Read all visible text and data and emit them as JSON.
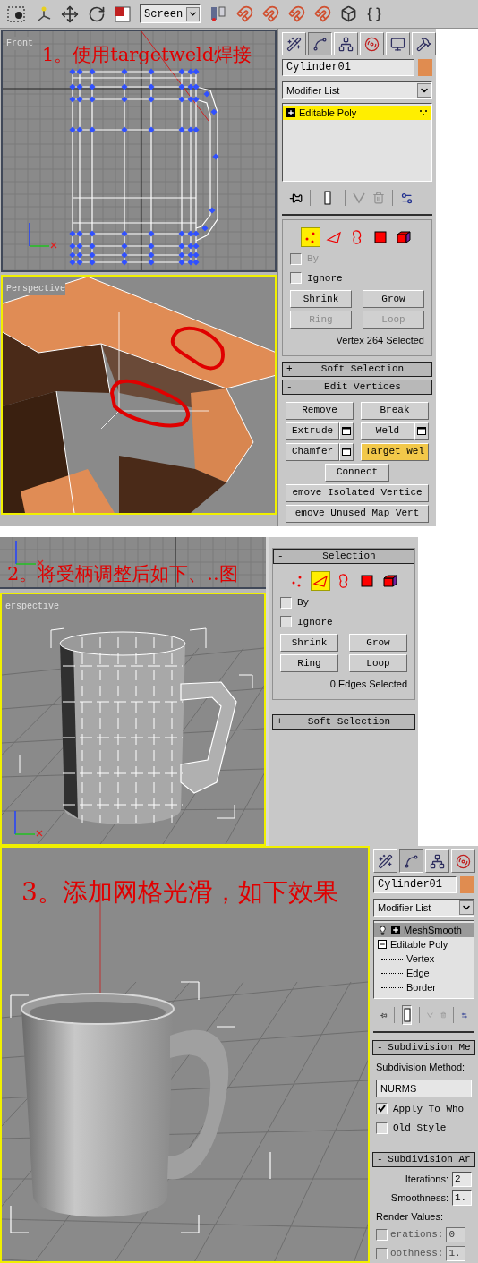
{
  "step1": {
    "caption": "1。使用targetweld焊接",
    "ref_coord": "Screen",
    "viewports": [
      {
        "label": "Front",
        "active": false
      },
      {
        "label": "Perspective",
        "active": true
      }
    ],
    "panel": {
      "tabs": [
        {
          "kind": "create",
          "selected": false
        },
        {
          "kind": "modify",
          "selected": true
        },
        {
          "kind": "hierarchy",
          "selected": false
        },
        {
          "kind": "motion",
          "selected": false
        },
        {
          "kind": "display",
          "selected": false
        },
        {
          "kind": "utilities",
          "selected": false
        }
      ],
      "object_name": "Cylinder01",
      "modifier_list": "Modifier List",
      "show_end_result": false,
      "stack": [
        {
          "label": "Editable Poly",
          "kind": "base",
          "selected": true,
          "expanded": false
        }
      ],
      "levels": [
        {
          "kind": "vertex",
          "selected": true
        },
        {
          "kind": "edge",
          "selected": false
        },
        {
          "kind": "border",
          "selected": false
        },
        {
          "kind": "polygon",
          "selected": false
        },
        {
          "kind": "element",
          "selected": false
        }
      ],
      "checkboxes": [
        {
          "label": "By",
          "checked": false,
          "disabled": true
        },
        {
          "label": "Ignore",
          "checked": false,
          "disabled": false
        }
      ],
      "buttons": [
        {
          "label": "Shrink",
          "disabled": false
        },
        {
          "label": "Grow",
          "disabled": false
        },
        {
          "label": "Ring",
          "disabled": true
        },
        {
          "label": "Loop",
          "disabled": true
        }
      ],
      "status": "Vertex 264 Selected",
      "soft_selection": {
        "sign": "+",
        "title": "Soft Selection"
      },
      "edit_vertices": {
        "sign": "-",
        "title": "Edit Vertices",
        "rows": [
          [
            {
              "label": "Remove",
              "settings": false,
              "active": false
            },
            {
              "label": "Break",
              "settings": false,
              "active": false
            }
          ],
          [
            {
              "label": "Extrude",
              "settings": true,
              "active": false
            },
            {
              "label": "Weld",
              "settings": true,
              "active": false
            }
          ],
          [
            {
              "label": "Chamfer",
              "settings": true,
              "active": false
            },
            {
              "label": "Target Wel",
              "settings": false,
              "active": true
            }
          ],
          [
            {
              "label": "Connect",
              "settings": false,
              "active": false
            }
          ],
          [
            {
              "label": "emove Isolated Vertice",
              "settings": false,
              "active": false
            }
          ],
          [
            {
              "label": "emove Unused Map Vert",
              "settings": false,
              "active": false
            }
          ]
        ]
      }
    }
  },
  "step2": {
    "caption": "2。将受柄调整后如下、..图",
    "viewport": {
      "label": "erspective",
      "active": true
    },
    "panel": {
      "selection": {
        "sign": "-",
        "title": "Selection"
      },
      "levels": [
        {
          "kind": "vertex",
          "selected": false
        },
        {
          "kind": "edge",
          "selected": true
        },
        {
          "kind": "border",
          "selected": false
        },
        {
          "kind": "polygon",
          "selected": false
        },
        {
          "kind": "element",
          "selected": false
        }
      ],
      "checkboxes": [
        {
          "label": "By",
          "checked": false,
          "disabled": false
        },
        {
          "label": "Ignore",
          "checked": false,
          "disabled": false
        }
      ],
      "buttons": [
        {
          "label": "Shrink",
          "disabled": false
        },
        {
          "label": "Grow",
          "disabled": false
        },
        {
          "label": "Ring",
          "disabled": false
        },
        {
          "label": "Loop",
          "disabled": false
        }
      ],
      "status": "0 Edges Selected",
      "soft_selection": {
        "sign": "+",
        "title": "Soft Selection"
      }
    }
  },
  "step3": {
    "caption": "3。添加网格光滑，如下效果",
    "viewport": {
      "active": true
    },
    "panel": {
      "tabs": [
        {
          "kind": "create",
          "selected": false
        },
        {
          "kind": "modify",
          "selected": true
        },
        {
          "kind": "hierarchy",
          "selected": false
        },
        {
          "kind": "motion",
          "selected": false
        }
      ],
      "object_name": "Cylinder01",
      "modifier_list": "Modifier List",
      "show_end_result": true,
      "stack": [
        {
          "label": "MeshSmooth",
          "kind": "modifier",
          "selected": true,
          "expanded": false
        },
        {
          "label": "Editable Poly",
          "kind": "base",
          "selected": false,
          "expanded": true,
          "children": [
            {
              "label": "Vertex"
            },
            {
              "label": "Edge"
            },
            {
              "label": "Border"
            }
          ]
        }
      ],
      "subdivision_method": {
        "sign": "-",
        "title": "Subdivision Me",
        "method_label": "Subdivision Method:",
        "method": "NURMS",
        "checkboxes": [
          {
            "label": "Apply To Who",
            "checked": true,
            "disabled": false
          },
          {
            "label": "Old Style",
            "checked": false,
            "disabled": false
          }
        ]
      },
      "subdivision_amount": {
        "sign": "-",
        "title": "Subdivision Ar",
        "fields": [
          {
            "label": "Iterations:",
            "value": "2"
          },
          {
            "label": "Smoothness:",
            "value": "1."
          }
        ],
        "render_label": "Render Values:",
        "render_fields": [
          {
            "label": "erations:",
            "value": "0",
            "checked": false,
            "disabled": true
          },
          {
            "label": "oothness:",
            "value": "1.",
            "checked": false,
            "disabled": true
          }
        ]
      }
    }
  }
}
